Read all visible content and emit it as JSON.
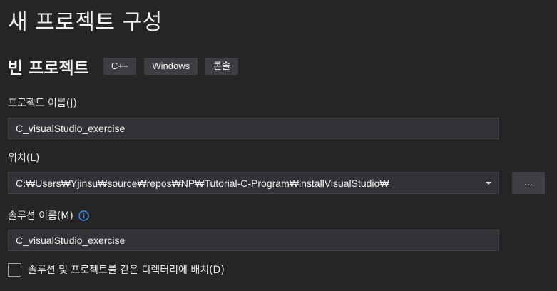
{
  "header": {
    "title": "새 프로젝트 구성",
    "subtitle": "빈 프로젝트",
    "tags": [
      "C++",
      "Windows",
      "콘솔"
    ]
  },
  "project_name": {
    "label": "프로젝트 이름(J)",
    "value": "C_visualStudio_exercise"
  },
  "location": {
    "label": "위치(L)",
    "value": "C:₩Users₩Yjinsu₩source₩repos₩NP₩Tutorial-C-Program₩installVisualStudio₩",
    "browse_label": "..."
  },
  "solution_name": {
    "label": "솔루션 이름(M)",
    "value": "C_visualStudio_exercise",
    "info_icon": "info-icon"
  },
  "same_directory": {
    "label": "솔루션 및 프로젝트를 같은 디렉터리에 배치(D)",
    "checked": false
  },
  "colors": {
    "background": "#252526",
    "field_bg": "#333337",
    "tag_bg": "#3e3e42",
    "info_accent": "#3794ff"
  }
}
